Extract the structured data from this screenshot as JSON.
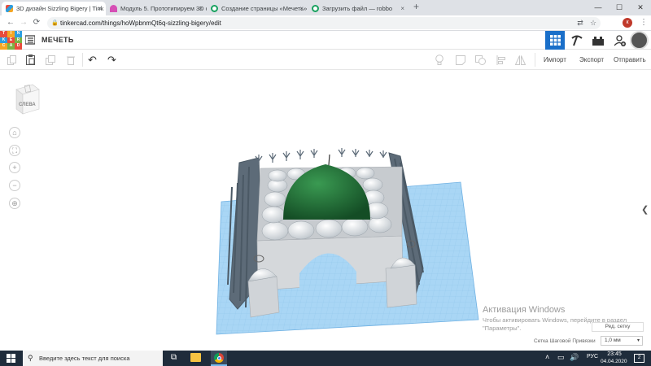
{
  "browser": {
    "tabs": [
      {
        "title": "3D дизайн Sizzling Bigery | Tink",
        "active": true,
        "favicon": "tinkercad-icon"
      },
      {
        "title": "Модуль 5. Прототипируем 3D о",
        "active": false,
        "favicon": "module-icon"
      },
      {
        "title": "Создание страницы «Мечеть»",
        "active": false,
        "favicon": "globe-icon"
      },
      {
        "title": "Загрузить файл — robbo",
        "active": false,
        "favicon": "globe-icon"
      }
    ],
    "new_tab": "+",
    "close_glyph": "×",
    "window_controls": {
      "minimize": "—",
      "maximize": "☐",
      "close": "✕"
    },
    "url": "tinkercad.com/things/hoWpbnmQt6q-sizzling-bigery/edit",
    "profile_initial": "к"
  },
  "tinkercad": {
    "logo_letters": [
      "TIN",
      "KER",
      "CAD"
    ],
    "project_name": "МЕЧЕТЬ",
    "toolbar": {
      "import_label": "Импорт",
      "export_label": "Экспорт",
      "send_label": "Отправить"
    },
    "viewcube_label": "СЛЕВА",
    "view_buttons": [
      "⌂",
      "⛶",
      "+",
      "−",
      "⊕"
    ],
    "side_panel_toggle": "❮"
  },
  "workplane": {
    "watermark_title": "Активация Windows",
    "watermark_line1": "Чтобы активировать Windows, перейдите в раздел",
    "watermark_line2": "\"Параметры\".",
    "edit_grid_label": "Ред. сетку",
    "snap_grid_label": "Сетка Шаговой Привязки",
    "snap_grid_value": "1,0 мм"
  },
  "taskbar": {
    "search_placeholder": "Введите здесь текст для поиска",
    "language": "РУС",
    "time": "23:45",
    "date": "04.04.2020",
    "notification_count": "2"
  },
  "colors": {
    "workplane_blue": "#a9d6f5",
    "dome_green": "#1f6a35",
    "tinkercad_accent": "#1a6fc9"
  }
}
